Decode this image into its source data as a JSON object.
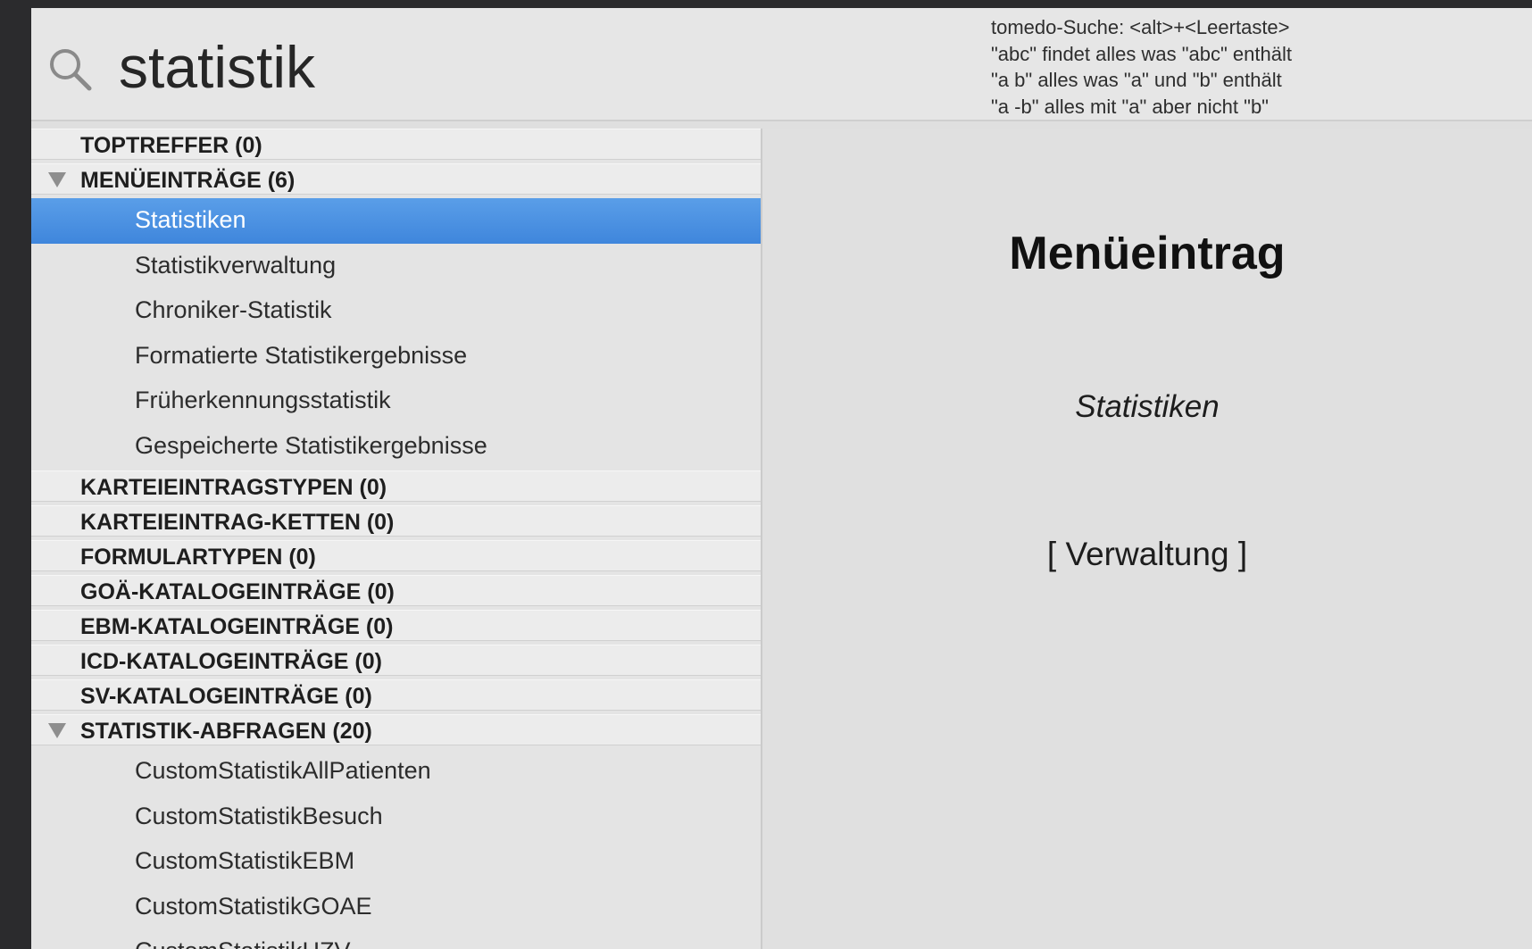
{
  "search": {
    "query": "statistik",
    "hints": [
      "tomedo-Suche: <alt>+<Leertaste>",
      "\"abc\" findet alles was \"abc\" enthält",
      "\"a b\" alles was \"a\" und \"b\" enthält",
      "\"a -b\" alles mit \"a\" aber nicht \"b\""
    ]
  },
  "groups": {
    "toptreffer": "TOPTREFFER (0)",
    "menu": {
      "title": "MENÜEINTRÄGE (6)",
      "items": [
        "Statistiken",
        "Statistikverwaltung",
        "Chroniker-Statistik",
        "Formatierte Statistikergebnisse",
        "Früherkennungsstatistik",
        "Gespeicherte Statistikergebnisse"
      ]
    },
    "karteieintragstypen": "KARTEIEINTRAGSTYPEN (0)",
    "karteieintrag_ketten": "KARTEIEINTRAG-KETTEN (0)",
    "formulartypen": "FORMULARTYPEN (0)",
    "goae": "GOÄ-KATALOGEINTRÄGE (0)",
    "ebm": "EBM-KATALOGEINTRÄGE (0)",
    "icd": "ICD-KATALOGEINTRÄGE (0)",
    "sv": "SV-KATALOGEINTRÄGE (0)",
    "statistik_abfragen": {
      "title": "STATISTIK-ABFRAGEN (20)",
      "items": [
        "CustomStatistikAllPatienten",
        "CustomStatistikBesuch",
        "CustomStatistikEBM",
        "CustomStatistikGOAE",
        "CustomStatistikHZV"
      ]
    }
  },
  "detail": {
    "heading": "Menüeintrag",
    "name": "Statistiken",
    "link": "[ Verwaltung ]"
  },
  "colors": {
    "selection": "#3f86dc",
    "background": "#dfdfdf"
  }
}
